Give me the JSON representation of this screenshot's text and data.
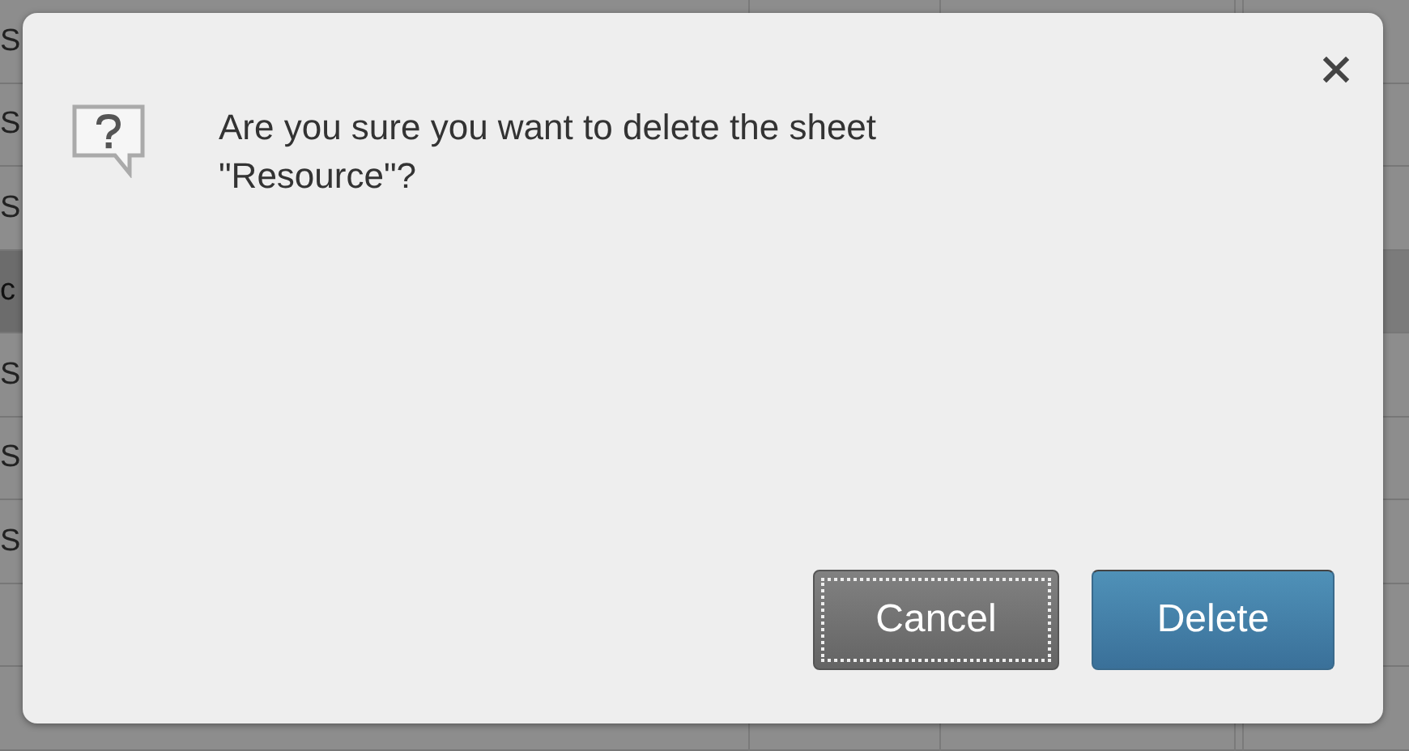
{
  "sheet": {
    "rows": [
      {
        "cell": "S",
        "selected": false
      },
      {
        "cell": "S",
        "selected": false
      },
      {
        "cell": "S",
        "selected": false
      },
      {
        "cell": "c",
        "selected": true
      },
      {
        "cell": "S",
        "selected": false
      },
      {
        "cell": "S",
        "selected": false
      },
      {
        "cell": "S",
        "selected": false
      },
      {
        "cell": "",
        "selected": false
      },
      {
        "cell": "",
        "selected": false
      }
    ]
  },
  "dialog": {
    "message": "Are you sure you want to delete the sheet \"Resource\"?",
    "buttons": [
      {
        "label": "Cancel",
        "kind": "secondary",
        "focused": true
      },
      {
        "label": "Delete",
        "kind": "primary",
        "focused": false
      }
    ]
  }
}
